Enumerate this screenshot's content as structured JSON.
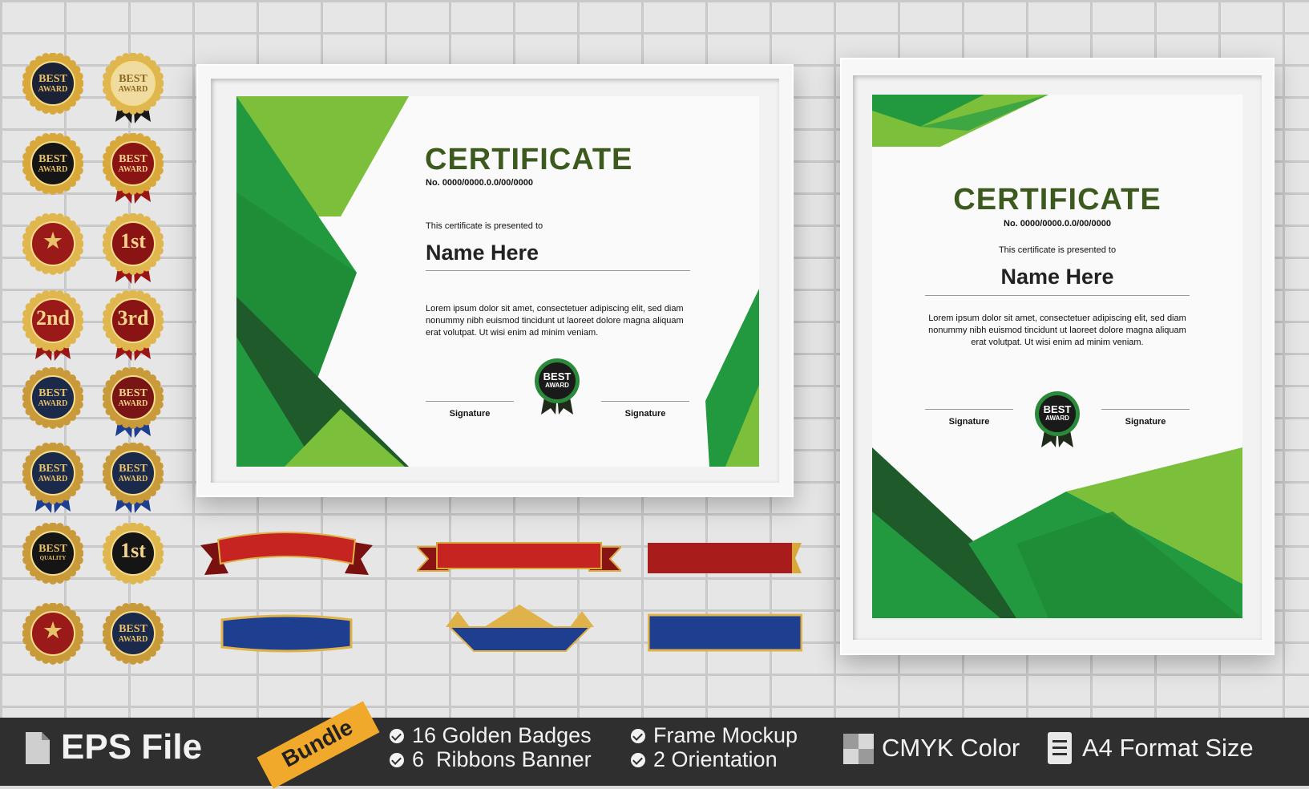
{
  "certificate_landscape": {
    "title": "CERTIFICATE",
    "number": "No. 0000/0000.0.0/00/0000",
    "presented": "This certificate is presented to",
    "name": "Name Here",
    "body": "Lorem ipsum dolor sit amet, consectetuer adipiscing elit, sed diam nonummy nibh euismod tincidunt ut laoreet dolore magna aliquam erat volutpat. Ut wisi enim ad minim veniam.",
    "signature_left": "Signature",
    "signature_right": "Signature",
    "badge_line1": "BEST",
    "badge_line2": "AWARD"
  },
  "certificate_portrait": {
    "title": "CERTIFICATE",
    "number": "No. 0000/0000.0.0/00/0000",
    "presented": "This certificate is presented to",
    "name": "Name Here",
    "body": "Lorem ipsum dolor sit amet, consectetuer adipiscing elit, sed diam nonummy nibh euismod tincidunt ut laoreet dolore magna aliquam erat volutpat. Ut wisi enim ad minim veniam.",
    "signature_left": "Signature",
    "signature_right": "Signature",
    "badge_line1": "BEST",
    "badge_line2": "AWARD"
  },
  "badges": [
    {
      "l1": "BEST",
      "l2": "AWARD"
    },
    {
      "l1": "BEST",
      "l2": "AWARD"
    },
    {
      "l1": "BEST",
      "l2": "AWARD"
    },
    {
      "l1": "BEST",
      "l2": "AWARD"
    },
    {
      "l1": "★",
      "l2": ""
    },
    {
      "l1": "1st",
      "l2": ""
    },
    {
      "l1": "2nd",
      "l2": ""
    },
    {
      "l1": "3rd",
      "l2": ""
    },
    {
      "l1": "BEST",
      "l2": "AWARD"
    },
    {
      "l1": "BEST",
      "l2": "AWARD"
    },
    {
      "l1": "BEST",
      "l2": "AWARD"
    },
    {
      "l1": "BEST",
      "l2": "AWARD"
    },
    {
      "l1": "BEST",
      "l2": "QUALITY"
    },
    {
      "l1": "1st",
      "l2": ""
    },
    {
      "l1": "★",
      "l2": ""
    },
    {
      "l1": "BEST",
      "l2": "AWARD"
    }
  ],
  "footer": {
    "file_label": "EPS File",
    "bundle_label": "Bundle",
    "feature1": "16 Golden Badges",
    "feature2": "6  Ribbons Banner",
    "feature3": "Frame Mockup",
    "feature4": "2 Orientation",
    "cmyk_label": "CMYK Color",
    "format_label": "A4 Format Size"
  },
  "colors": {
    "green_dark": "#1e5a2a",
    "green_mid": "#23993f",
    "green_light": "#7bbf3a",
    "title_green": "#3c5a1e",
    "gold": "#d8a93a",
    "red": "#b3201e",
    "blue": "#1e3f8f",
    "bar_bg": "#2f2f2f"
  }
}
